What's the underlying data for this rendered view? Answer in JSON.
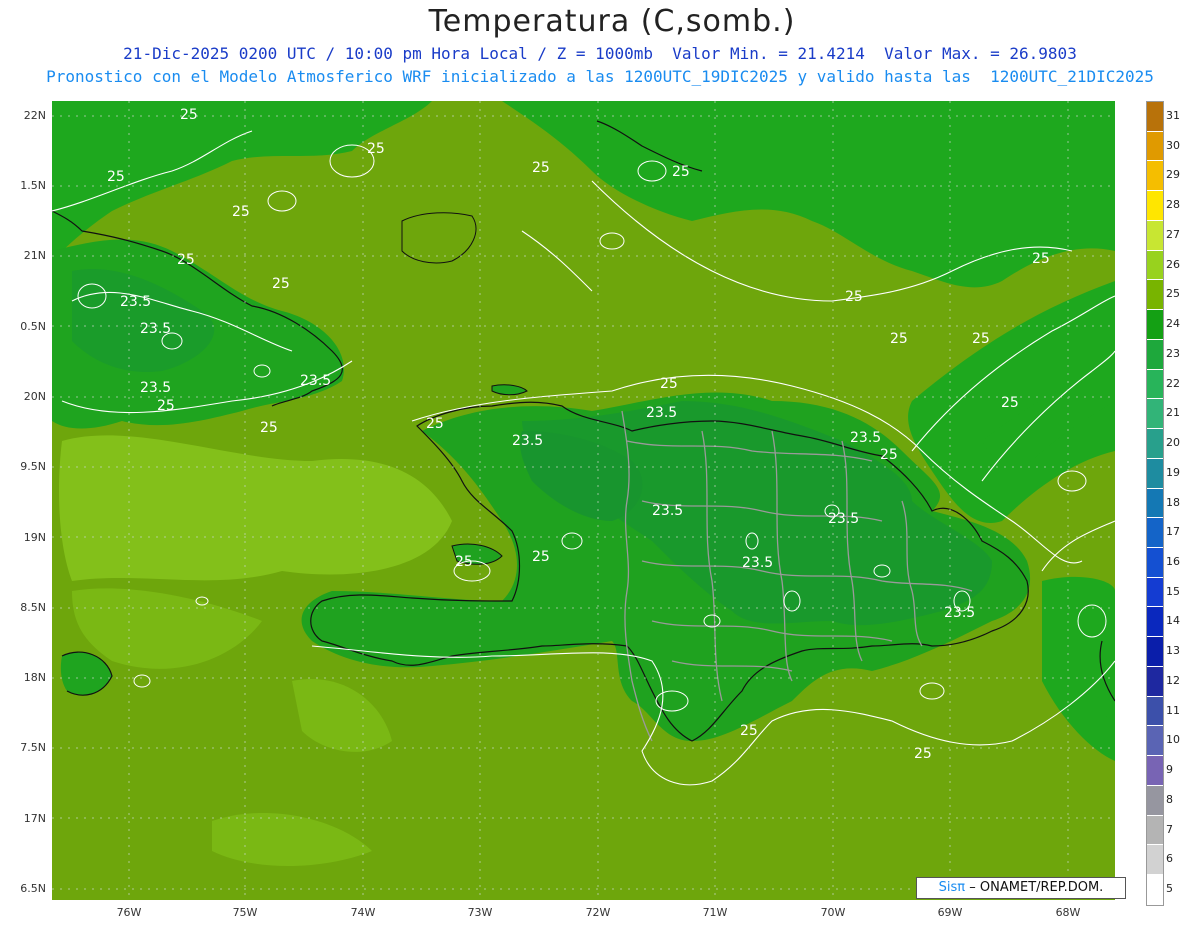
{
  "title": "Temperatura (C,somb.)",
  "subtitle_line1": "21-Dic-2025 0200 UTC / 10:00 pm Hora Local / Z = 1000mb  Valor Min. = 21.4214  Valor Max. = 26.9803",
  "subtitle_line2": "Pronostico con el Modelo Atmosferico WRF inicializado a las 1200UTC_19DIC2025 y valido hasta las  1200UTC_21DIC2025",
  "credit": {
    "brand": "Sisπ",
    "rest": "– ONAMET/REP.DOM."
  },
  "lat_labels": [
    "22N",
    "1.5N",
    "21N",
    "0.5N",
    "20N",
    "9.5N",
    "19N",
    "8.5N",
    "18N",
    "7.5N",
    "17N",
    "6.5N"
  ],
  "lon_labels": [
    "76W",
    "75W",
    "74W",
    "73W",
    "72W",
    "71W",
    "70W",
    "69W",
    "68W"
  ],
  "colorbar": {
    "labels": [
      "31",
      "30",
      "29",
      "28",
      "27",
      "26",
      "25",
      "24",
      "23",
      "22",
      "21",
      "20",
      "19",
      "18",
      "17",
      "16",
      "15",
      "14",
      "13",
      "12",
      "11",
      "10",
      "9",
      "8",
      "7",
      "6",
      "5"
    ],
    "colors": [
      "#b8720a",
      "#e09a00",
      "#f5be00",
      "#ffe600",
      "#c8e632",
      "#98d21e",
      "#78b400",
      "#14a014",
      "#1ea83c",
      "#28b45a",
      "#32b478",
      "#28a08c",
      "#1e8ca0",
      "#1478b4",
      "#1464c8",
      "#1450d2",
      "#143cd2",
      "#0a28be",
      "#0a1eaa",
      "#1e28a0",
      "#3c50aa",
      "#5a64b4",
      "#7864b4",
      "#9696a0",
      "#b4b4b4",
      "#d2d2d2",
      "#ffffff"
    ]
  },
  "colors": {
    "sea": "#6fa80a",
    "land_base": "#1fa21f",
    "land_light": "#0aa00a",
    "sea_pale": "#85c414",
    "pale": "#98d21e",
    "border": "#999999",
    "coast": "#111111",
    "contour": "#ffffff"
  },
  "contour_labels": [
    "25",
    "25",
    "25",
    "25",
    "25",
    "25",
    "25",
    "25",
    "25",
    "25",
    "25",
    "25",
    "25",
    "25",
    "25",
    "25",
    "25",
    "25",
    "25",
    "25",
    "25",
    "25",
    "23.5",
    "23.5",
    "23.5",
    "23.5",
    "23.5",
    "23.5",
    "23.5",
    "23.5",
    "23.5",
    "23.5",
    "23.5"
  ]
}
